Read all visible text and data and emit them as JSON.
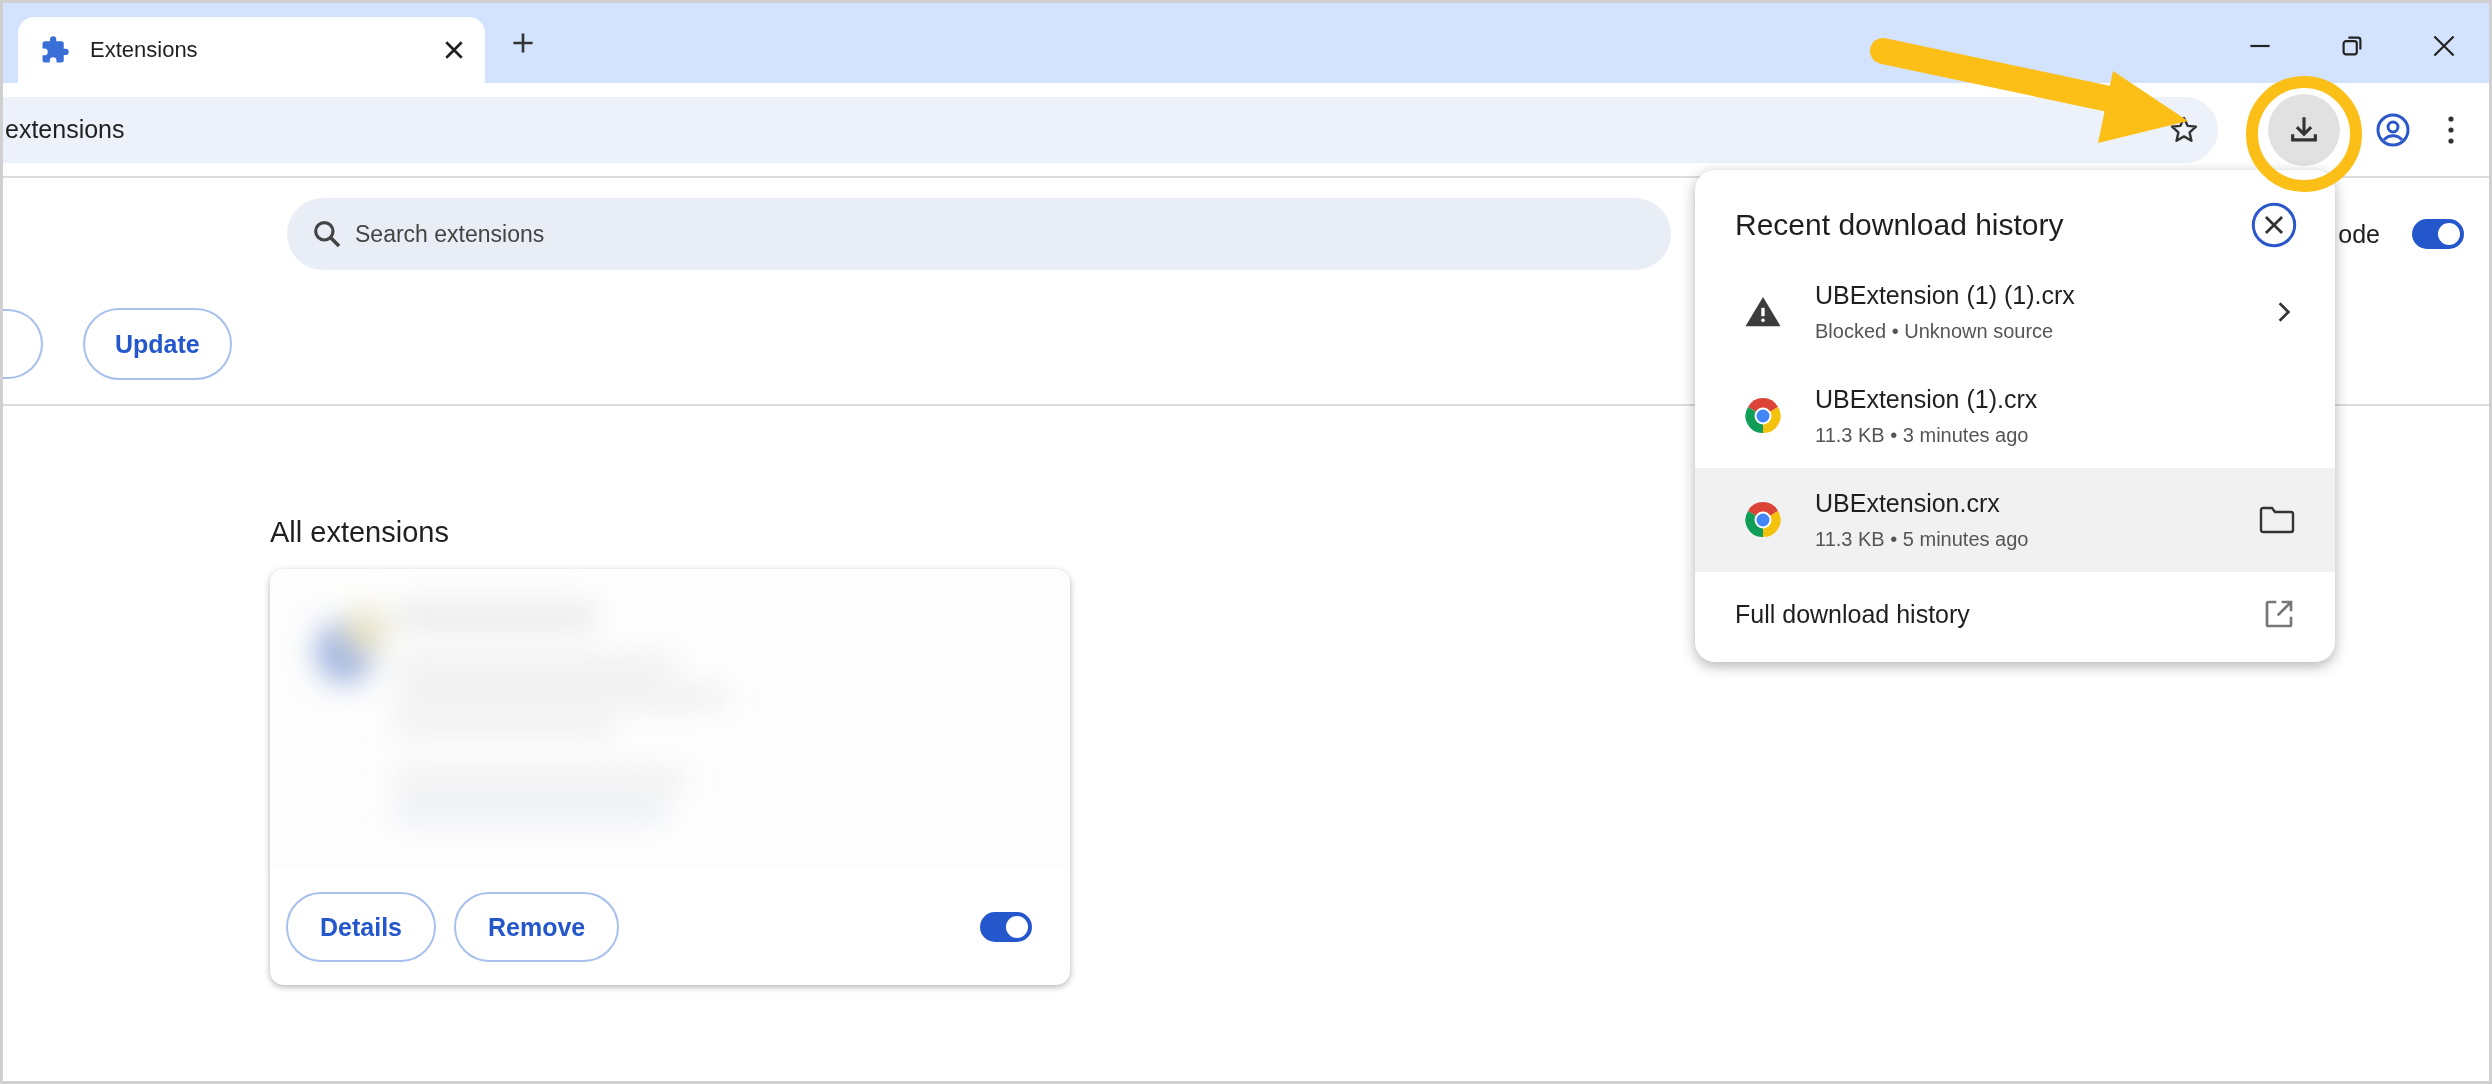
{
  "tab": {
    "title": "Extensions"
  },
  "address_bar": {
    "text": "extensions"
  },
  "search": {
    "placeholder": "Search extensions"
  },
  "developer_mode": {
    "label": "ode",
    "on": true
  },
  "action_buttons": [
    "Update"
  ],
  "section_title": "All extensions",
  "extension_card": {
    "enabled": true,
    "buttons": [
      "Details",
      "Remove"
    ]
  },
  "downloads_popup": {
    "title": "Recent download history",
    "items": [
      {
        "kind": "blocked",
        "name": "UBExtension (1) (1).crx",
        "detail": "Blocked • Unknown source",
        "selected": false
      },
      {
        "kind": "file",
        "name": "UBExtension (1).crx",
        "detail": "11.3 KB • 3 minutes ago",
        "selected": false
      },
      {
        "kind": "file",
        "name": "UBExtension.crx",
        "detail": "11.3 KB • 5 minutes ago",
        "selected": true
      }
    ],
    "footer": "Full download history"
  }
}
